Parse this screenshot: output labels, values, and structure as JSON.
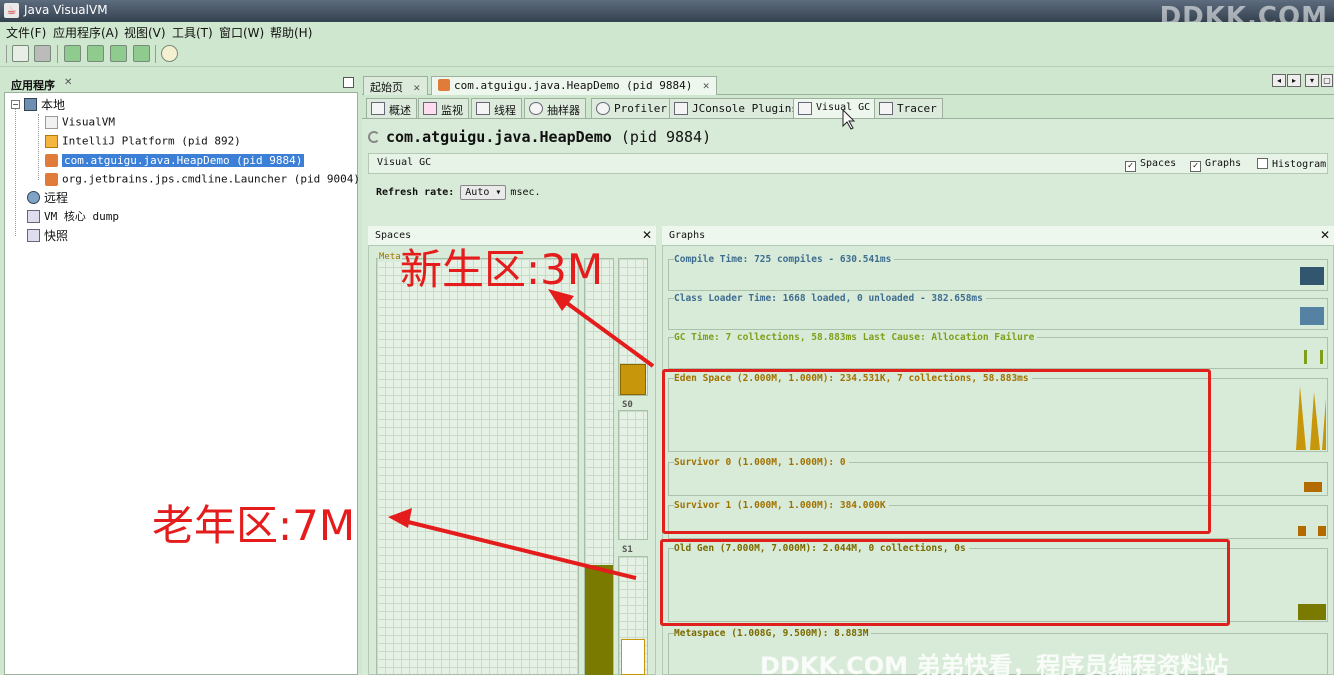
{
  "window": {
    "title": "Java VisualVM"
  },
  "watermarks": {
    "top": "DDKK.COM",
    "bottom": "DDKK.COM 弟弟快看，程序员编程资料站"
  },
  "menu": [
    "文件(F)",
    "应用程序(A)",
    "视图(V)",
    "工具(T)",
    "窗口(W)",
    "帮助(H)"
  ],
  "left_panel": {
    "tab_label": "应用程序",
    "tree": {
      "local": "本地",
      "local_items": [
        "VisualVM",
        "IntelliJ Platform (pid 892)",
        "com.atguigu.java.HeapDemo (pid 9884)",
        "org.jetbrains.jps.cmdline.Launcher (pid 9004)"
      ],
      "remote": "远程",
      "vm_core": "VM 核心 dump",
      "snapshots": "快照"
    }
  },
  "doc_tabs": [
    "起始页",
    "com.atguigu.java.HeapDemo (pid 9884)"
  ],
  "sub_tabs": [
    "概述",
    "监视",
    "线程",
    "抽样器",
    "Profiler",
    "JConsole Plugins",
    "Visual GC",
    "Tracer"
  ],
  "heading": {
    "app": "com.atguigu.java.HeapDemo",
    "pid": "(pid 9884)"
  },
  "visual_gc": {
    "label": "Visual GC",
    "checkboxes": [
      {
        "label": "Spaces",
        "checked": true
      },
      {
        "label": "Graphs",
        "checked": true
      },
      {
        "label": "Histogram",
        "checked": false
      }
    ],
    "refresh_label": "Refresh rate:",
    "refresh_value": "Auto",
    "refresh_unit": "msec."
  },
  "spaces_panel": {
    "title": "Spaces",
    "metaspace_label": "Meta",
    "s0_label": "S0",
    "s1_label": "S1",
    "colors": {
      "old": "#7a7a00",
      "eden": "#c8960a",
      "survivor": "#ffffff"
    }
  },
  "graphs_panel": {
    "title": "Graphs",
    "rows": [
      {
        "label": "Compile Time: 725 compiles - 630.541ms",
        "color": "#3f6d90"
      },
      {
        "label": "Class Loader Time: 1668 loaded, 0 unloaded - 382.658ms",
        "color": "#3f6d90"
      },
      {
        "label": "GC Time: 7 collections, 58.883ms Last Cause: Allocation Failure",
        "color": "#7f9f1c"
      },
      {
        "label": "Eden Space (2.000M, 1.000M): 234.531K, 7 collections, 58.883ms",
        "color": "#a07100"
      },
      {
        "label": "Survivor 0 (1.000M, 1.000M): 0",
        "color": "#a07100"
      },
      {
        "label": "Survivor 1 (1.000M, 1.000M): 384.000K",
        "color": "#a07100"
      },
      {
        "label": "Old Gen (7.000M, 7.000M): 2.044M, 0 collections, 0s",
        "color": "#7a6a00"
      },
      {
        "label": "Metaspace (1.008G, 9.500M): 8.883M",
        "color": "#7a6a00"
      }
    ]
  },
  "annotations": {
    "young": "新生区:3M",
    "old": "老年区:7M"
  }
}
